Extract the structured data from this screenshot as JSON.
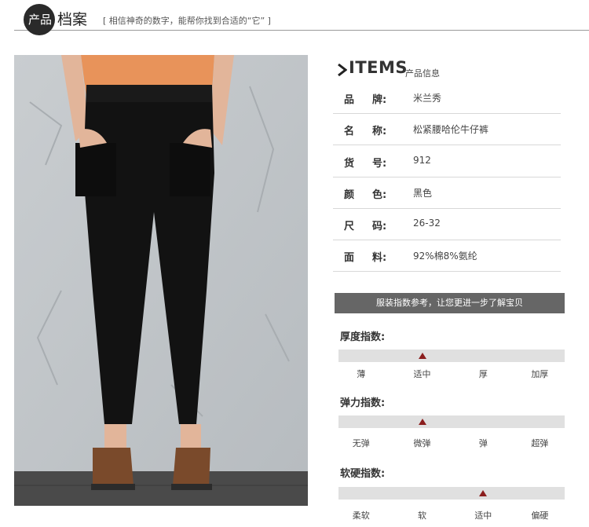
{
  "header": {
    "logo_text": "产品",
    "title": "档案",
    "slogan": "[ 相信神奇的数字，能帮你找到合适的“它” ]"
  },
  "items": {
    "title": "ITEMS",
    "subtitle": "产品信息",
    "rows": [
      {
        "k1": "品",
        "k2": "牌:",
        "value": "米兰秀"
      },
      {
        "k1": "名",
        "k2": "称:",
        "value": "松紧腰哈伦牛仔裤"
      },
      {
        "k1": "货",
        "k2": "号:",
        "value": "912"
      },
      {
        "k1": "颜",
        "k2": "色:",
        "value": "黑色"
      },
      {
        "k1": "尺",
        "k2": "码:",
        "value": "26-32"
      },
      {
        "k1": "面",
        "k2": "料:",
        "value": "92%棉8%氨纶"
      }
    ]
  },
  "banner": "服装指数参考，让您更进一步了解宝贝",
  "gauges": [
    {
      "title": "厚度指数:",
      "labels": [
        "薄",
        "适中",
        "厚",
        "加厚"
      ],
      "selected_index": 1
    },
    {
      "title": "弹力指数:",
      "labels": [
        "无弹",
        "微弹",
        "弹",
        "超弹"
      ],
      "selected_index": 1
    },
    {
      "title": "软硬指数:",
      "labels": [
        "柔软",
        "软",
        "适中",
        "偏硬"
      ],
      "selected_index": 2
    }
  ],
  "colors": {
    "accent": "#8b1e1e",
    "banner": "#666666",
    "pants": "#111111",
    "top": "#e8935a"
  }
}
